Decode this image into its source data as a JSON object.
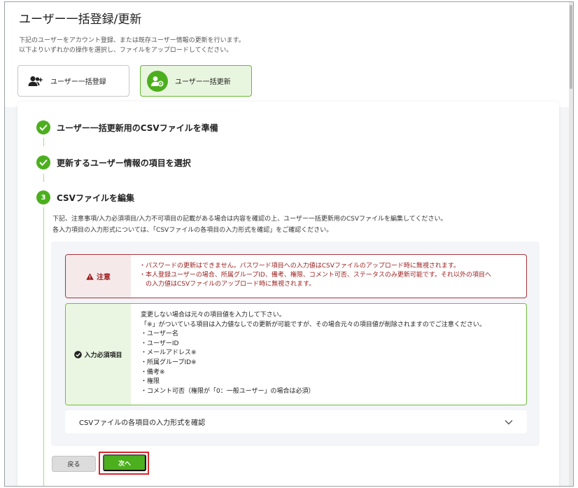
{
  "page": {
    "title": "ユーザー一括登録/更新",
    "description": [
      "下記のユーザーをアカウント登録、または既存ユーザー情報の更新を行います。",
      "以下よりいずれかの操作を選択し、ファイルをアップロードしてください。"
    ]
  },
  "modes": {
    "register_label": "ユーザー一括登録",
    "update_label": "ユーザー一括更新"
  },
  "steps": [
    {
      "title": "ユーザー一括更新用のCSVファイルを準備",
      "status": "done"
    },
    {
      "title": "更新するユーザー情報の項目を選択",
      "status": "done"
    },
    {
      "number": "3",
      "title": "CSVファイルを編集",
      "status": "current"
    }
  ],
  "step3": {
    "description": [
      "下記、注意事項/入力必須項目/入力不可項目の記載がある場合は内容を確認の上、ユーザー一括更新用のCSVファイルを編集してください。",
      "各入力項目の入力形式については、「CSVファイルの各項目の入力形式を確認」をご確認ください。"
    ]
  },
  "notice": {
    "label": "注意",
    "lines": [
      "・パスワードの更新はできません。パスワード項目への入力値はCSVファイルのアップロード時に無視されます。",
      "・本人登録ユーザーの場合、所属グループID、備考、権限、コメント可否、ステータスのみ更新可能です。それ以外の項目へ",
      "　の入力値はCSVファイルのアップロード時に無視されます。"
    ]
  },
  "required": {
    "label": "入力必須項目",
    "lines": [
      "変更しない場合は元々の項目値を入力して下さい。",
      "「※」がついている項目は入力値なしでの更新が可能ですが、その場合元々の項目値が削除されますのでご注意ください。",
      "・ユーザー名",
      "・ユーザーID",
      "・メールアドレス※",
      "・所属グループID※",
      "・備考※",
      "・権限",
      "・コメント可否（権限が「0：一般ユーザー」の場合は必須）"
    ]
  },
  "accordion": {
    "label": "CSVファイルの各項目の入力形式を確認"
  },
  "buttons": {
    "back": "戻る",
    "next": "次へ"
  },
  "colors": {
    "accent_green": "#4caf1e",
    "notice_red": "#9b1c1c",
    "highlight_red": "#d9262b"
  }
}
